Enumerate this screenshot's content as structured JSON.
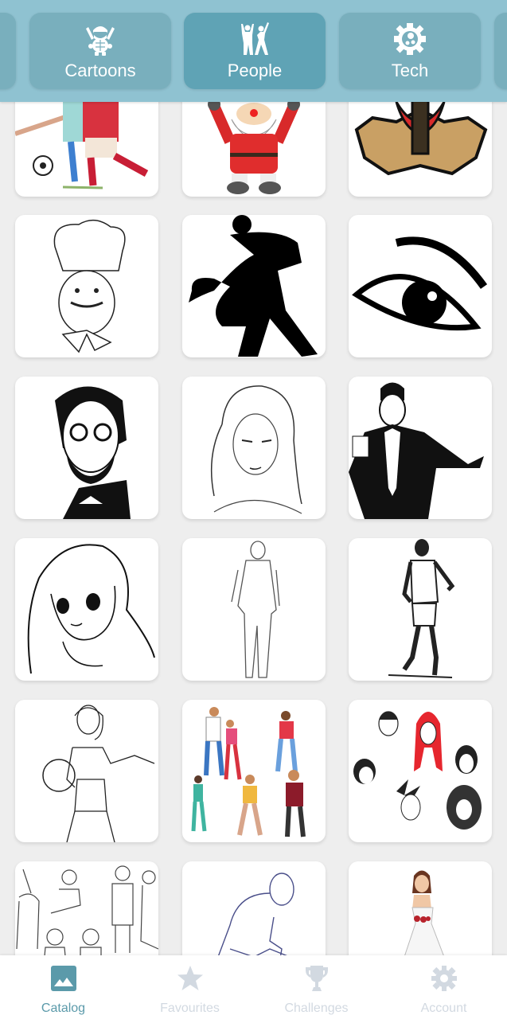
{
  "categories": [
    {
      "label": "",
      "icon": "partial-category-icon",
      "active": false
    },
    {
      "label": "Cartoons",
      "icon": "turtle-icon",
      "active": false
    },
    {
      "label": "People",
      "icon": "dancing-people-icon",
      "active": true
    },
    {
      "label": "Tech",
      "icon": "gear-chip-icon",
      "active": false
    },
    {
      "label": "",
      "icon": "partial-category-icon",
      "active": false
    }
  ],
  "catalog": {
    "rows": [
      [
        "soccer-players-drawing",
        "santa-claus-drawing",
        "spartan-helmet-drawing"
      ],
      [
        "chef-caricature-drawing",
        "dancing-couple-silhouette",
        "eye-drawing"
      ],
      [
        "bearded-man-glasses-drawing",
        "girl-sketch-drawing",
        "magician-with-cards-drawing"
      ],
      [
        "anime-girl-drawing",
        "man-in-suit-sketch",
        "runner-drawing"
      ],
      [
        "woman-fitness-drawing",
        "colorful-people-group",
        "hairstyles-drawing"
      ],
      [
        "children-sketch-drawing",
        "thinker-figure-sketch",
        "woman-in-dress-drawing"
      ]
    ]
  },
  "bottom_nav": [
    {
      "label": "Catalog",
      "icon": "image-icon",
      "active": true
    },
    {
      "label": "Favourites",
      "icon": "star-icon",
      "active": false
    },
    {
      "label": "Challenges",
      "icon": "trophy-icon",
      "active": false
    },
    {
      "label": "Account",
      "icon": "gear-icon",
      "active": false
    }
  ],
  "colors": {
    "topbar": "#8fc2d1",
    "category": "#79afbd",
    "category_active": "#5fa3b5",
    "nav_active": "#5b9aaa",
    "nav_inactive": "#d2d9e1"
  }
}
